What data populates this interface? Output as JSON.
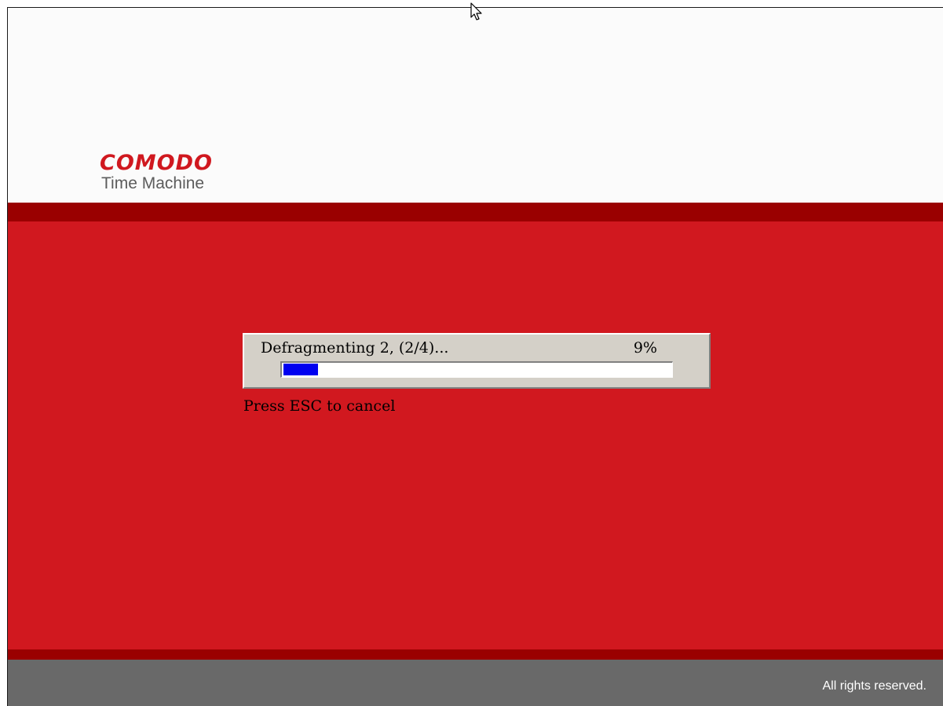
{
  "header": {
    "brand": "COMODO",
    "product": "Time Machine"
  },
  "progress": {
    "message": "Defragmenting 2, (2/4)...",
    "percent_label": "9%",
    "fraction": 0.09
  },
  "hint": "Press ESC to cancel",
  "footer": {
    "text": "All rights reserved."
  },
  "colors": {
    "brand_red": "#d1181f",
    "band_dark_red": "#9a0000",
    "progress_fill": "#0000f0",
    "footer_gray": "#696969"
  },
  "icons": {
    "cursor": "mouse-pointer-icon"
  }
}
